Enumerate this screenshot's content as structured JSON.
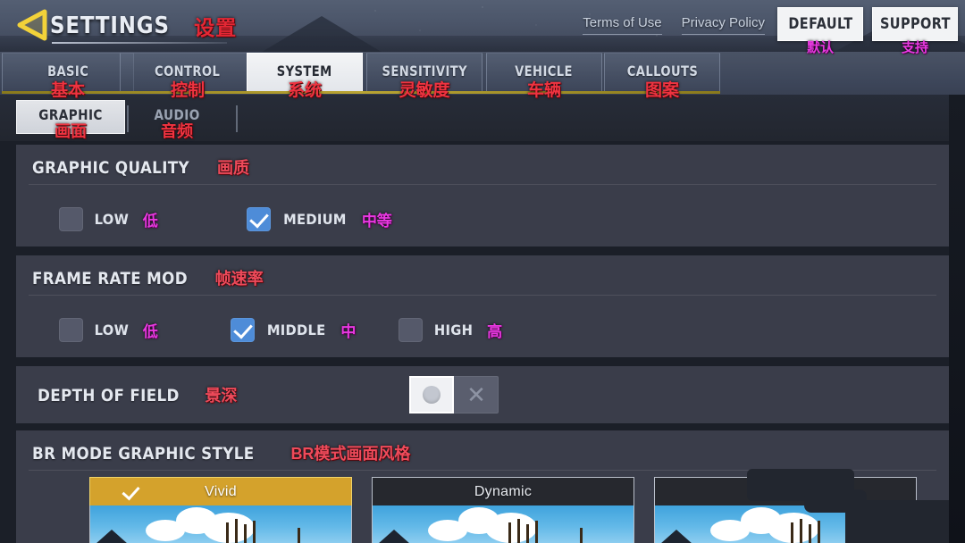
{
  "header": {
    "back_icon": "back-arrow-icon",
    "title_en": "SETTINGS",
    "title_cn": "设置",
    "links": [
      {
        "label": "Terms of Use"
      },
      {
        "label": "Privacy Policy"
      }
    ],
    "buttons": [
      {
        "label": "DEFAULT",
        "label_cn": "默认"
      },
      {
        "label": "SUPPORT",
        "label_cn": "支持"
      }
    ]
  },
  "tabs": [
    {
      "label": "BASIC",
      "label_cn": "基本",
      "active": false
    },
    {
      "label": "CONTROL",
      "label_cn": "控制",
      "active": false
    },
    {
      "label": "SYSTEM",
      "label_cn": "系统",
      "active": true
    },
    {
      "label": "SENSITIVITY",
      "label_cn": "灵敏度",
      "active": false
    },
    {
      "label": "VEHICLE",
      "label_cn": "车辆",
      "active": false
    },
    {
      "label": "CALLOUTS",
      "label_cn": "图案",
      "active": false
    }
  ],
  "subtabs": [
    {
      "label": "GRAPHIC",
      "label_cn": "画面",
      "active": true
    },
    {
      "label": "AUDIO",
      "label_cn": "音频",
      "active": false
    }
  ],
  "sections": {
    "graphic_quality": {
      "title_en": "GRAPHIC QUALITY",
      "title_cn": "画质",
      "options": [
        {
          "label": "LOW",
          "label_cn": "低",
          "checked": false
        },
        {
          "label": "MEDIUM",
          "label_cn": "中等",
          "checked": true
        }
      ]
    },
    "frame_rate": {
      "title_en": "FRAME RATE MOD",
      "title_cn": "帧速率",
      "options": [
        {
          "label": "LOW",
          "label_cn": "低",
          "checked": false
        },
        {
          "label": "MIDDLE",
          "label_cn": "中",
          "checked": true
        },
        {
          "label": "HIGH",
          "label_cn": "高",
          "checked": false
        }
      ]
    },
    "depth_of_field": {
      "title_en": "DEPTH OF FIELD",
      "title_cn": "景深",
      "toggle_state": "off",
      "toggle_off_icon": "close-x-icon"
    },
    "br_style": {
      "title_en": "BR MODE GRAPHIC STYLE",
      "title_cn": "BR模式画面风格",
      "cards": [
        {
          "label": "Vivid",
          "selected": true
        },
        {
          "label": "Dynamic",
          "selected": false
        },
        {
          "label": "",
          "selected": false
        }
      ]
    }
  },
  "colors": {
    "accent_gold": "#d4a22c",
    "checkbox_blue": "#4e8cd8",
    "cn_red": "#ef3340",
    "cn_magenta": "#e838e0",
    "panel_bg": "#3a3d4a"
  }
}
